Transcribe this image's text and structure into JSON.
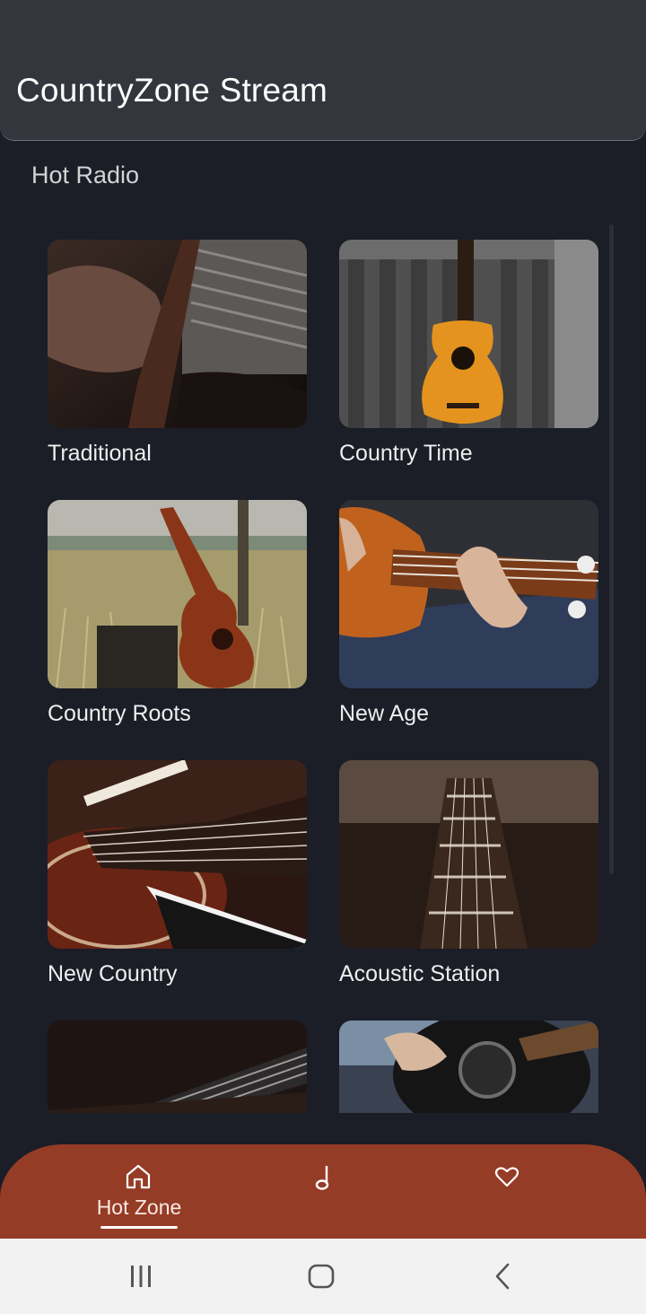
{
  "app": {
    "title": "CountryZone Stream"
  },
  "section": {
    "title": "Hot Radio"
  },
  "stations": [
    {
      "label": "Traditional"
    },
    {
      "label": "Country Time"
    },
    {
      "label": "Country Roots"
    },
    {
      "label": "New Age"
    },
    {
      "label": "New Country"
    },
    {
      "label": "Acoustic Station"
    },
    {
      "label": ""
    },
    {
      "label": ""
    }
  ],
  "bottom_nav": {
    "items": [
      {
        "label": "Hot Zone",
        "icon": "home-icon",
        "active": true
      },
      {
        "label": "",
        "icon": "music-note-icon",
        "active": false
      },
      {
        "label": "",
        "icon": "heart-icon",
        "active": false
      }
    ],
    "background": "#953c26"
  },
  "system_nav": {
    "icons": [
      "recent-apps-icon",
      "home-circle-icon",
      "back-icon"
    ]
  },
  "colors": {
    "background": "#1b1d27",
    "header": "#33363d",
    "accent": "#953c26"
  }
}
